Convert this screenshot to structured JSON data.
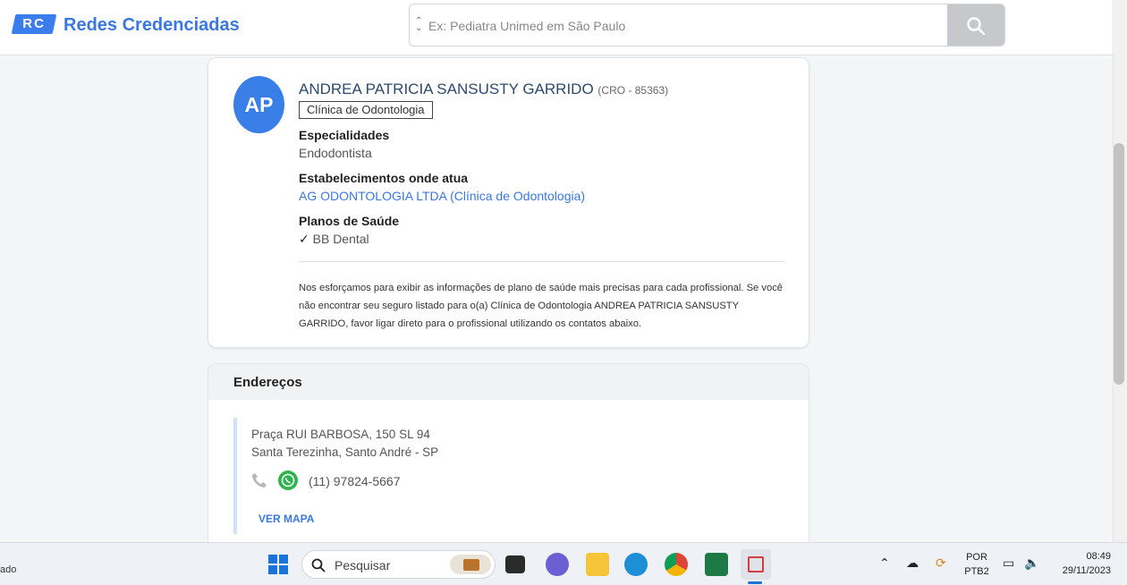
{
  "header": {
    "logo_text": "RC",
    "brand": "Redes Credenciadas",
    "search_placeholder": "Ex: Pediatra Unimed em São Paulo"
  },
  "profile": {
    "initials": "AP",
    "name": "ANDREA PATRICIA SANSUSTY GARRIDO",
    "registry": "(CRO - 85363)",
    "type": "Clínica de Odontologia",
    "specialties_label": "Especialidades",
    "specialty": "Endodontista",
    "establishments_label": "Estabelecimentos onde atua",
    "establishment": "AG ODONTOLOGIA LTDA (Clínica de Odontologia)",
    "plans_label": "Planos de Saúde",
    "plan": "BB Dental",
    "disclaimer": "Nos esforçamos para exibir as informações de plano de saúde mais precisas para cada profissional. Se você não encontrar seu seguro listado para o(a) Clínica de Odontologia ANDREA PATRICIA SANSUSTY GARRIDO, favor ligar direto para o profissional utilizando os contatos abaixo."
  },
  "addresses": {
    "title": "Endereços",
    "line1": "Praça RUI BARBOSA, 150 SL 94",
    "line2": "Santa Terezinha, Santo André - SP",
    "phone": "(11) 97824-5667",
    "map_link": "VER MAPA"
  },
  "taskbar": {
    "left_fragment": "ado",
    "search_label": "Pesquisar",
    "lang_top": "POR",
    "lang_bottom": "PTB2",
    "time": "08:49",
    "date": "29/11/2023"
  },
  "colors": {
    "accent": "#3a78e0",
    "avatar": "#3a7ee8",
    "whatsapp": "#2fb34f"
  }
}
